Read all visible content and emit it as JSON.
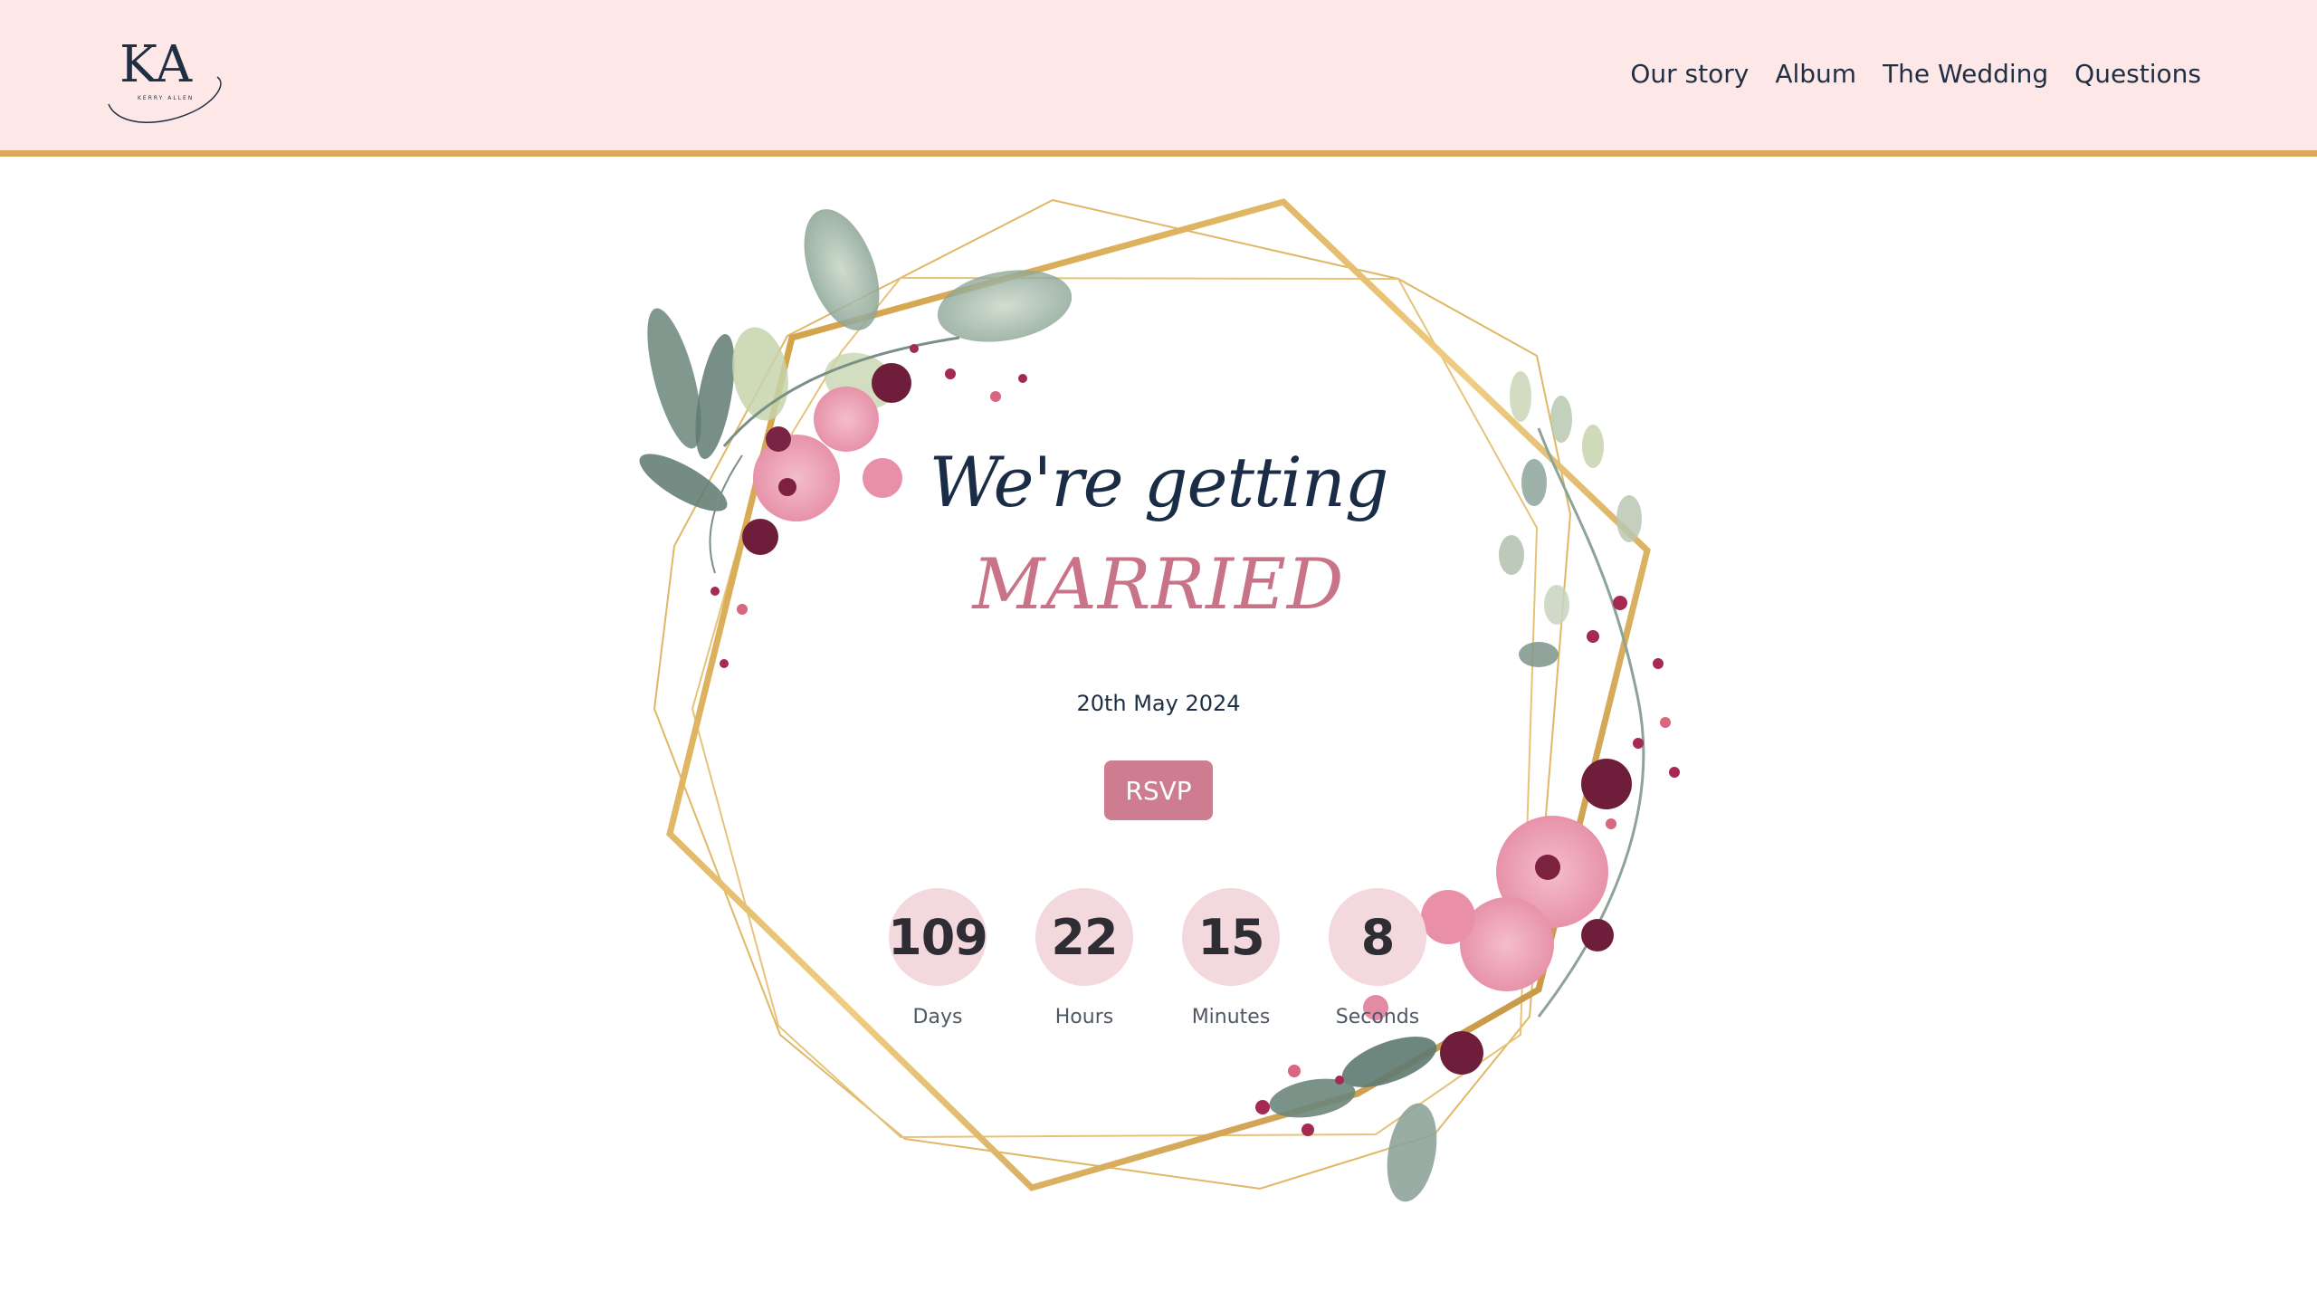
{
  "header": {
    "logo": {
      "initials": "KA",
      "names": "KERRY ALLEN"
    },
    "nav": [
      "Our story",
      "Album",
      "The Wedding",
      "Questions"
    ]
  },
  "hero": {
    "title_line1": "We're getting",
    "title_line2": "MARRIED",
    "date": "20th May 2024",
    "rsvp_label": "RSVP"
  },
  "countdown": [
    {
      "value": "109",
      "label": "Days"
    },
    {
      "value": "22",
      "label": "Hours"
    },
    {
      "value": "15",
      "label": "Minutes"
    },
    {
      "value": "8",
      "label": "Seconds"
    }
  ],
  "colors": {
    "header_bg": "#fde7e7",
    "header_border": "#dea65a",
    "navy": "#1f2f44",
    "accent_pink": "#cd7d8f",
    "bubble": "#f3d8de",
    "gold": "#d4a24c"
  }
}
